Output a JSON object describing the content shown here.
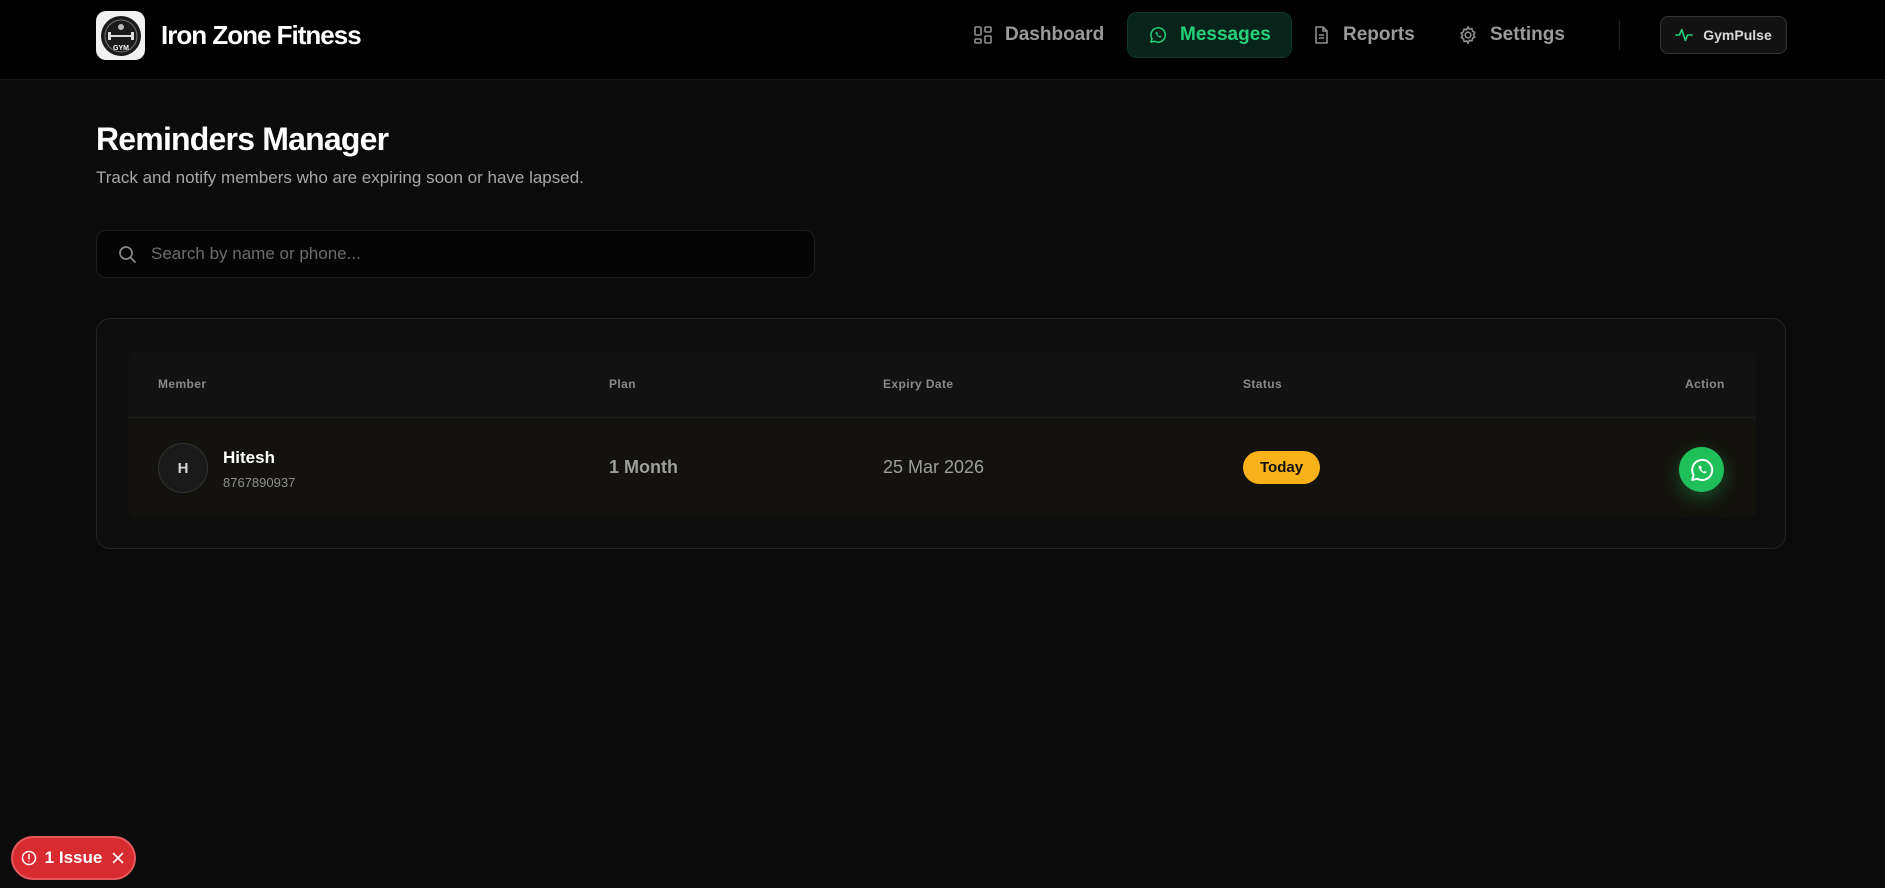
{
  "app": {
    "brand_name": "Iron Zone Fitness",
    "logo_text": "GYM"
  },
  "nav": {
    "items": [
      {
        "label": "Dashboard",
        "icon": "dashboard-grid-icon",
        "active": false
      },
      {
        "label": "Messages",
        "icon": "whatsapp-icon",
        "active": true
      },
      {
        "label": "Reports",
        "icon": "document-icon",
        "active": false
      },
      {
        "label": "Settings",
        "icon": "gear-icon",
        "active": false
      }
    ],
    "pulse_button": {
      "label": "GymPulse",
      "icon": "activity-pulse-icon"
    }
  },
  "page": {
    "title": "Reminders Manager",
    "subtitle": "Track and notify members who are expiring soon or have lapsed."
  },
  "search": {
    "placeholder": "Search by name or phone...",
    "value": ""
  },
  "table": {
    "columns": [
      "Member",
      "Plan",
      "Expiry Date",
      "Status",
      "Action"
    ],
    "rows": [
      {
        "avatar_initial": "H",
        "name": "Hitesh",
        "phone": "8767890937",
        "plan": "1 Month",
        "expiry_date": "25 Mar 2026",
        "status": "Today",
        "action_icon": "whatsapp-icon"
      }
    ]
  },
  "issues": {
    "label": "1 Issue"
  },
  "colors": {
    "accent_green": "#25d07a",
    "whatsapp_green": "#1fbf5a",
    "status_today": "#f7b21a",
    "issue_red": "#d72b2f",
    "background": "#0b0b0b"
  }
}
